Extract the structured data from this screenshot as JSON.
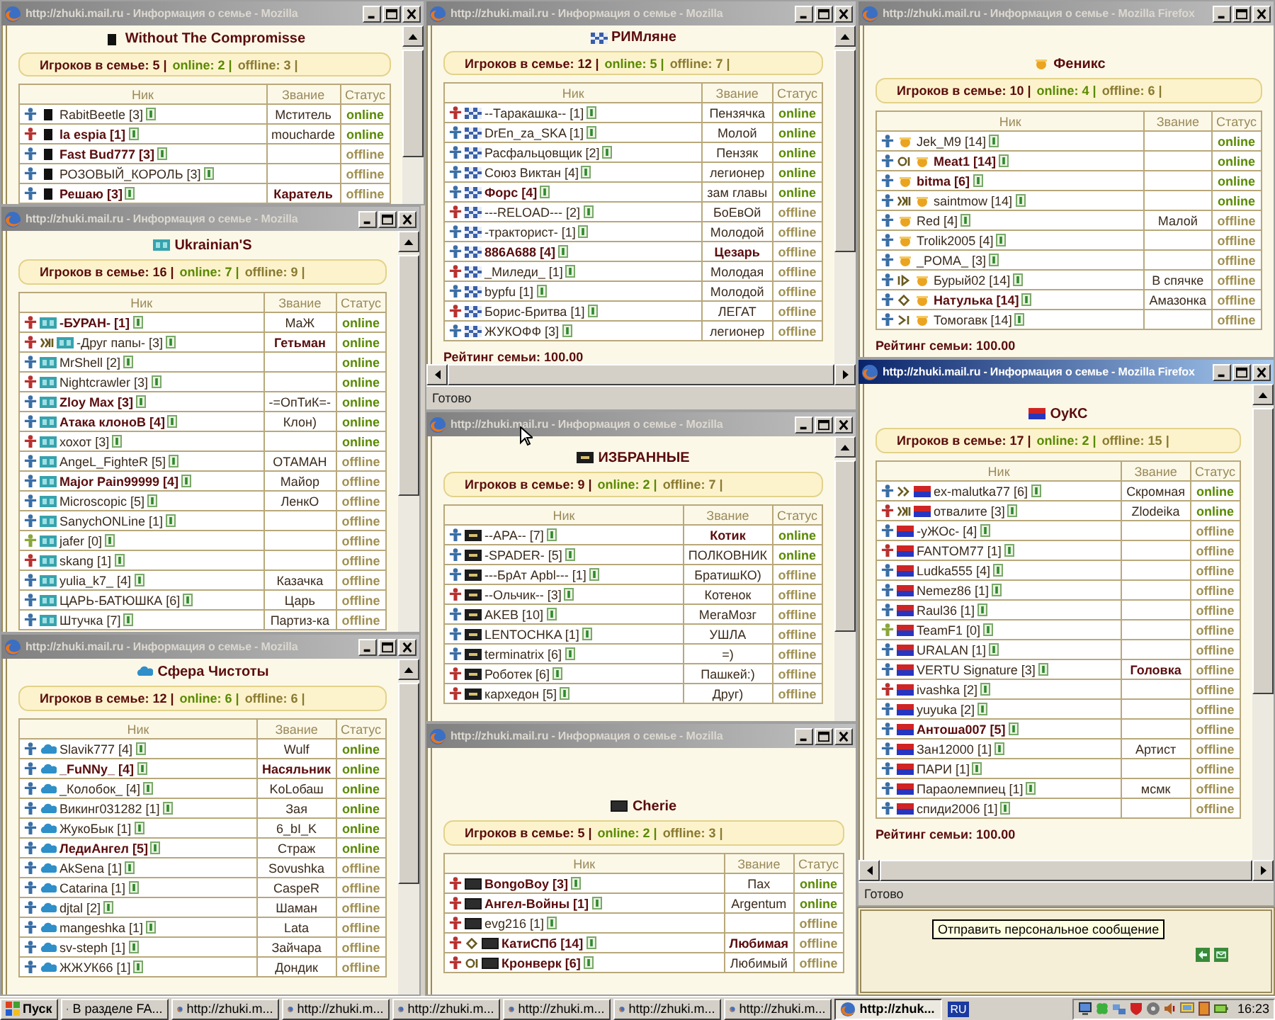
{
  "windows": [
    {
      "title": "http://zhuki.mail.ru - Информация о семье - Mozilla",
      "active": false,
      "clan_icon": {
        "kind": "black"
      },
      "family": "Without The Compromisse",
      "summary": {
        "total": "Игроков в семье: 5 |",
        "online": "online: 2 |",
        "offline": "offline: 3 |"
      },
      "columns": [
        "Ник",
        "Звание",
        "Статус"
      ],
      "rows": [
        {
          "color": "#3a6ea5",
          "nick": "RabitBeetle [3]",
          "rank": "Мститель",
          "online": true,
          "status": "online"
        },
        {
          "color": "#b8312f",
          "nick": "la espia [1]",
          "bold": true,
          "rank": "moucharde",
          "online": true,
          "status": "online"
        },
        {
          "color": "#3a6ea5",
          "nick": "Fast Bud777 [3]",
          "bold": true,
          "online": false,
          "status": "offline"
        },
        {
          "color": "#3a6ea5",
          "nick": "РОЗОВЫЙ_КОРОЛЬ [3]",
          "online": false,
          "status": "offline"
        },
        {
          "color": "#3a6ea5",
          "nick": "Решаю [3]",
          "bold": true,
          "rank": "Каратель",
          "rank_bold": true,
          "online": false,
          "status": "offline"
        }
      ]
    },
    {
      "title": "http://zhuki.mail.ru - Информация о семье - Mozilla",
      "active": false,
      "clan_icon": {
        "kind": "teal"
      },
      "family": "Ukrainian'S",
      "summary": {
        "total": "Игроков в семье: 16 |",
        "online": "online: 7 |",
        "offline": "offline: 9 |"
      },
      "columns": [
        "Ник",
        "Звание",
        "Статус"
      ],
      "rows": [
        {
          "color": "#b8312f",
          "nick": "-БУРАН- [1]",
          "bold": true,
          "rank": "МаЖ",
          "online": true,
          "status": "online"
        },
        {
          "color": "#b8312f",
          "badge": {
            "kind": "zigzag"
          },
          "nick": "-Друг папы- [3]",
          "rank": "Гетьман",
          "rank_bold": true,
          "online": true,
          "status": "online"
        },
        {
          "color": "#3a6ea5",
          "nick": "MrShell [2]",
          "online": true,
          "status": "online"
        },
        {
          "color": "#b8312f",
          "nick": "Nightcrawler [3]",
          "online": true,
          "status": "online"
        },
        {
          "color": "#3a6ea5",
          "nick": "Zloy Max [3]",
          "bold": true,
          "rank": "-=ОпТиК=-",
          "online": true,
          "status": "online"
        },
        {
          "color": "#3a6ea5",
          "nick": "Атака клоноВ [4]",
          "bold": true,
          "rank": "Клон)",
          "online": true,
          "status": "online"
        },
        {
          "color": "#b8312f",
          "nick": "хохот [3]",
          "online": true,
          "status": "online"
        },
        {
          "color": "#3a6ea5",
          "nick": "AngeL_FighteR [5]",
          "rank": "ОТАМАН",
          "online": false,
          "status": "offline"
        },
        {
          "color": "#3a6ea5",
          "nick": "Major Pain99999 [4]",
          "bold": true,
          "rank": "Майор",
          "online": false,
          "status": "offline"
        },
        {
          "color": "#3a6ea5",
          "nick": "Microscopic [5]",
          "rank": "ЛенкО",
          "online": false,
          "status": "offline"
        },
        {
          "color": "#3a6ea5",
          "nick": "SanychONLine [1]",
          "online": false,
          "status": "offline"
        },
        {
          "color": "#8aa63a",
          "nick": "jafer [0]",
          "online": false,
          "status": "offline"
        },
        {
          "color": "#b8312f",
          "nick": "skang [1]",
          "online": false,
          "status": "offline"
        },
        {
          "color": "#3a6ea5",
          "nick": "yulia_k7_ [4]",
          "rank": "Казачка",
          "online": false,
          "status": "offline"
        },
        {
          "color": "#3a6ea5",
          "nick": "ЦАРЬ-БАТЮШКА [6]",
          "rank": "Царь",
          "online": false,
          "status": "offline"
        },
        {
          "color": "#3a6ea5",
          "nick": "Штучка [7]",
          "rank": "Партиз-ка",
          "online": false,
          "status": "offline"
        }
      ]
    },
    {
      "title": "http://zhuki.mail.ru - Информация о семье - Mozilla",
      "active": false,
      "clan_icon": {
        "kind": "cloud"
      },
      "family": "Сфера Чистоты",
      "summary": {
        "total": "Игроков в семье: 12 |",
        "online": "online: 6 |",
        "offline": "offline: 6 |"
      },
      "columns": [
        "Ник",
        "Звание",
        "Статус"
      ],
      "rows": [
        {
          "color": "#3a6ea5",
          "nick": "Slavik777 [4]",
          "rank": "Wulf",
          "online": true,
          "status": "online"
        },
        {
          "color": "#3a6ea5",
          "nick": "_FuNNy_ [4]",
          "bold": true,
          "rank": "Насяльник",
          "rank_bold": true,
          "online": true,
          "status": "online"
        },
        {
          "color": "#3a6ea5",
          "nick": "_Колобок_ [4]",
          "rank": "KoLoбаш",
          "online": true,
          "status": "online"
        },
        {
          "color": "#3a6ea5",
          "nick": "Викинг031282 [1]",
          "rank": "Зая",
          "online": true,
          "status": "online"
        },
        {
          "color": "#3a6ea5",
          "nick": "ЖукоБык [1]",
          "rank": "6_bI_K",
          "online": true,
          "status": "online"
        },
        {
          "color": "#3a6ea5",
          "nick": "ЛедиАнгел [5]",
          "bold": true,
          "rank": "Страж",
          "online": true,
          "status": "online"
        },
        {
          "color": "#3a6ea5",
          "nick": "AkSena [1]",
          "rank": "Sovushka",
          "online": false,
          "status": "offline"
        },
        {
          "color": "#3a6ea5",
          "nick": "Catarina [1]",
          "rank": "CaspeR",
          "online": false,
          "status": "offline"
        },
        {
          "color": "#3a6ea5",
          "nick": "djtal [2]",
          "rank": "Шаман",
          "online": false,
          "status": "offline"
        },
        {
          "color": "#3a6ea5",
          "nick": "mangeshka [1]",
          "rank": "Lata",
          "online": false,
          "status": "offline"
        },
        {
          "color": "#3a6ea5",
          "nick": "sv-steph [1]",
          "rank": "Зайчара",
          "online": false,
          "status": "offline"
        },
        {
          "color": "#3a6ea5",
          "nick": "ЖЖУК66 [1]",
          "rank": "Дондик",
          "online": false,
          "status": "offline"
        }
      ]
    },
    {
      "title": "http://zhuki.mail.ru - Информация о семье - Mozilla",
      "active": false,
      "clan_icon": {
        "kind": "checker"
      },
      "family": "РИМляне",
      "summary": {
        "total": "Игроков в семье: 12 |",
        "online": "online: 5 |",
        "offline": "offline: 7 |"
      },
      "columns": [
        "Ник",
        "Звание",
        "Статус"
      ],
      "rows": [
        {
          "color": "#b8312f",
          "nick": "--Таракашка-- [1]",
          "rank": "Пензячка",
          "online": true,
          "status": "online"
        },
        {
          "color": "#3a6ea5",
          "nick": "DrEn_za_SKA [1]",
          "rank": "Молой",
          "online": true,
          "status": "online"
        },
        {
          "color": "#3a6ea5",
          "nick": "Расфальцовщик [2]",
          "rank": "Пензяк",
          "online": true,
          "status": "online"
        },
        {
          "color": "#3a6ea5",
          "nick": "Союз Виктан [4]",
          "rank": "легионер",
          "online": true,
          "status": "online"
        },
        {
          "color": "#3a6ea5",
          "nick": "Форс [4]",
          "bold": true,
          "rank": "зам главы",
          "online": true,
          "status": "online"
        },
        {
          "color": "#b8312f",
          "nick": "---RELOAD--- [2]",
          "rank": "БоЕвОй",
          "online": false,
          "status": "offline"
        },
        {
          "color": "#3a6ea5",
          "nick": "-тракторист- [1]",
          "rank": "Молодой",
          "online": false,
          "status": "offline"
        },
        {
          "color": "#3a6ea5",
          "nick": "886А688 [4]",
          "bold": true,
          "rank": "Цезарь",
          "rank_bold": true,
          "online": false,
          "status": "offline"
        },
        {
          "color": "#b8312f",
          "nick": "_Миледи_ [1]",
          "rank": "Молодая",
          "online": false,
          "status": "offline"
        },
        {
          "color": "#3a6ea5",
          "nick": "bypfu [1]",
          "rank": "Молодой",
          "online": false,
          "status": "offline"
        },
        {
          "color": "#b8312f",
          "nick": "Борис-Бритва [1]",
          "rank": "ЛЕГАТ",
          "online": false,
          "status": "offline"
        },
        {
          "color": "#3a6ea5",
          "nick": "ЖУКОФФ [3]",
          "rank": "легионер",
          "online": false,
          "status": "offline"
        }
      ],
      "rating": "Рейтинг семьи: 100.00",
      "status_bar": "Готово"
    },
    {
      "title": "http://zhuki.mail.ru - Информация о семье - Mozilla",
      "active": false,
      "clan_icon": {
        "kind": "hbox"
      },
      "family": "ИЗБРАННЫЕ",
      "summary": {
        "total": "Игроков в семье: 9 |",
        "online": "online: 2 |",
        "offline": "offline: 7 |"
      },
      "columns": [
        "Ник",
        "Звание",
        "Статус"
      ],
      "rows": [
        {
          "color": "#3a6ea5",
          "nick": "--APA-- [7]",
          "rank": "Котик",
          "rank_bold": true,
          "online": true,
          "status": "online"
        },
        {
          "color": "#3a6ea5",
          "nick": "-SPADER- [5]",
          "rank": "ПОЛКОВНИК",
          "online": true,
          "status": "online"
        },
        {
          "color": "#3a6ea5",
          "nick": "---БрАт Арbl--- [1]",
          "rank": "БратишКО)",
          "online": false,
          "status": "offline"
        },
        {
          "color": "#b8312f",
          "nick": "--Ольчик-- [3]",
          "rank": "Котенок",
          "online": false,
          "status": "offline"
        },
        {
          "color": "#3a6ea5",
          "nick": "AKEB [10]",
          "rank": "МегаМозг",
          "online": false,
          "status": "offline"
        },
        {
          "color": "#3a6ea5",
          "nick": "LENTOCHKA [1]",
          "rank": "УШЛА",
          "online": false,
          "status": "offline"
        },
        {
          "color": "#3a6ea5",
          "nick": "terminatrix [6]",
          "rank": "=)",
          "online": false,
          "status": "offline"
        },
        {
          "color": "#b8312f",
          "nick": "Роботек [6]",
          "rank": "Пашкей:)",
          "online": false,
          "status": "offline"
        },
        {
          "color": "#b8312f",
          "nick": "кархедон [5]",
          "rank": "Друг)",
          "online": false,
          "status": "offline"
        }
      ]
    },
    {
      "title": "http://zhuki.mail.ru - Информация о семье - Mozilla",
      "active": false,
      "clan_icon": {
        "kind": "dark"
      },
      "family": "Cherie",
      "summary": {
        "total": "Игроков в семье: 5 |",
        "online": "online: 2 |",
        "offline": "offline: 3 |"
      },
      "columns": [
        "Ник",
        "Звание",
        "Статус"
      ],
      "rows": [
        {
          "color": "#b8312f",
          "nick": "BongoBoy [3]",
          "bold": true,
          "rank": "Пах",
          "online": true,
          "status": "online"
        },
        {
          "color": "#b8312f",
          "nick": "Ангел-Войны [1]",
          "bold": true,
          "rank": "Argentum",
          "online": true,
          "status": "online"
        },
        {
          "color": "#b8312f",
          "nick": "evg216 [1]",
          "online": false,
          "status": "offline"
        },
        {
          "color": "#b8312f",
          "badge": {
            "kind": "diamond"
          },
          "nick": "КатиСПб [14]",
          "bold": true,
          "rank": "Любимая",
          "rank_bold": true,
          "online": false,
          "status": "offline"
        },
        {
          "color": "#b8312f",
          "badge": {
            "kind": "ring"
          },
          "nick": "Кронверк [6]",
          "bold": true,
          "rank": "Любимый",
          "online": false,
          "status": "offline"
        }
      ]
    },
    {
      "title": "http://zhuki.mail.ru - Информация о семье - Mozilla Firefox",
      "active": false,
      "clan_icon": {
        "kind": "sun"
      },
      "family": "Феникс",
      "summary": {
        "total": "Игроков в семье: 10 |",
        "online": "online: 4 |",
        "offline": "offline: 6 |"
      },
      "columns": [
        "Ник",
        "Звание",
        "Статус"
      ],
      "rows": [
        {
          "color": "#3a6ea5",
          "nick": "Jek_M9 [14]",
          "online": true,
          "status": "online"
        },
        {
          "color": "#3a6ea5",
          "badge": {
            "kind": "ring"
          },
          "nick": "Meat1 [14]",
          "bold": true,
          "online": true,
          "status": "online"
        },
        {
          "color": "#3a6ea5",
          "nick": "bitma [6]",
          "bold": true,
          "online": true,
          "status": "online"
        },
        {
          "color": "#3a6ea5",
          "badge": {
            "kind": "zigzag"
          },
          "nick": "saintmow [14]",
          "online": true,
          "status": "online"
        },
        {
          "color": "#3a6ea5",
          "nick": "Red [4]",
          "rank": "Малой",
          "online": false,
          "status": "offline"
        },
        {
          "color": "#3a6ea5",
          "nick": "Trolik2005 [4]",
          "online": false,
          "status": "offline"
        },
        {
          "color": "#3a6ea5",
          "nick": "_POMA_ [3]",
          "online": false,
          "status": "offline"
        },
        {
          "color": "#3a6ea5",
          "badge": {
            "kind": "play"
          },
          "nick": "Бурый02 [14]",
          "rank": "В спячке",
          "online": false,
          "status": "offline"
        },
        {
          "color": "#3a6ea5",
          "badge": {
            "kind": "diamond"
          },
          "nick": "Натулька [14]",
          "bold": true,
          "rank": "Амазонка",
          "online": false,
          "status": "offline"
        },
        {
          "color": "#3a6ea5",
          "badge": {
            "kind": "skip"
          },
          "nick": "Томогавк [14]",
          "online": false,
          "status": "offline"
        }
      ],
      "rating": "Рейтинг семьи: 100.00"
    },
    {
      "title": "http://zhuki.mail.ru - Информация о семье - Mozilla Firefox",
      "active": true,
      "clan_icon": {
        "kind": "stripes"
      },
      "family": "ОуКС",
      "summary": {
        "total": "Игроков в семье: 17 |",
        "online": "online: 2 |",
        "offline": "offline: 15 |"
      },
      "columns": [
        "Ник",
        "Звание",
        "Статус"
      ],
      "rows": [
        {
          "color": "#3a6ea5",
          "badge": {
            "kind": "chevrons"
          },
          "nick": "ex-malutka77 [6]",
          "rank": "Скромная",
          "online": true,
          "status": "online"
        },
        {
          "color": "#b8312f",
          "badge": {
            "kind": "zigzag"
          },
          "nick": "отвалите [3]",
          "rank": "Zlodeika",
          "online": true,
          "status": "online"
        },
        {
          "color": "#3a6ea5",
          "nick": "-уЖОс- [4]",
          "online": false,
          "status": "offline"
        },
        {
          "color": "#b8312f",
          "nick": "FANTOM77 [1]",
          "online": false,
          "status": "offline"
        },
        {
          "color": "#3a6ea5",
          "nick": "Ludka555 [4]",
          "online": false,
          "status": "offline"
        },
        {
          "color": "#3a6ea5",
          "nick": "Nemez86 [1]",
          "online": false,
          "status": "offline"
        },
        {
          "color": "#3a6ea5",
          "nick": "Raul36 [1]",
          "online": false,
          "status": "offline"
        },
        {
          "color": "#8aa63a",
          "nick": "TeamF1 [0]",
          "online": false,
          "status": "offline"
        },
        {
          "color": "#3a6ea5",
          "nick": "URALAN [1]",
          "online": false,
          "status": "offline"
        },
        {
          "color": "#3a6ea5",
          "nick": "VERTU Signature [3]",
          "rank": "Головка",
          "rank_bold": true,
          "online": false,
          "status": "offline"
        },
        {
          "color": "#b8312f",
          "nick": "ivashka [2]",
          "online": false,
          "status": "offline"
        },
        {
          "color": "#3a6ea5",
          "nick": "yuyuka [2]",
          "online": false,
          "status": "offline"
        },
        {
          "color": "#3a6ea5",
          "nick": "Антоша007 [5]",
          "bold": true,
          "online": false,
          "status": "offline"
        },
        {
          "color": "#3a6ea5",
          "nick": "Зан12000 [1]",
          "rank": "Артист",
          "online": false,
          "status": "offline"
        },
        {
          "color": "#3a6ea5",
          "nick": "ПАРИ [1]",
          "online": false,
          "status": "offline"
        },
        {
          "color": "#3a6ea5",
          "nick": "Параолемпиец [1]",
          "rank": "мсмк",
          "online": false,
          "status": "offline"
        },
        {
          "color": "#3a6ea5",
          "nick": "спиди2006 [1]",
          "online": false,
          "status": "offline"
        }
      ],
      "rating": "Рейтинг семьи: 100.00",
      "status_bar": "Готово"
    }
  ],
  "tooltip": "Отправить персональное сообщение",
  "taskbar": {
    "start": "Пуск",
    "tasks": [
      {
        "label": "В разделе FA...",
        "selected": false
      },
      {
        "label": "http://zhuki.m...",
        "selected": false
      },
      {
        "label": "http://zhuki.m...",
        "selected": false
      },
      {
        "label": "http://zhuki.m...",
        "selected": false
      },
      {
        "label": "http://zhuki.m...",
        "selected": false
      },
      {
        "label": "http://zhuki.m...",
        "selected": false
      },
      {
        "label": "http://zhuki.m...",
        "selected": false
      },
      {
        "label": "http://zhuk...",
        "selected": true
      }
    ],
    "language": "RU",
    "clock": "16:23"
  }
}
